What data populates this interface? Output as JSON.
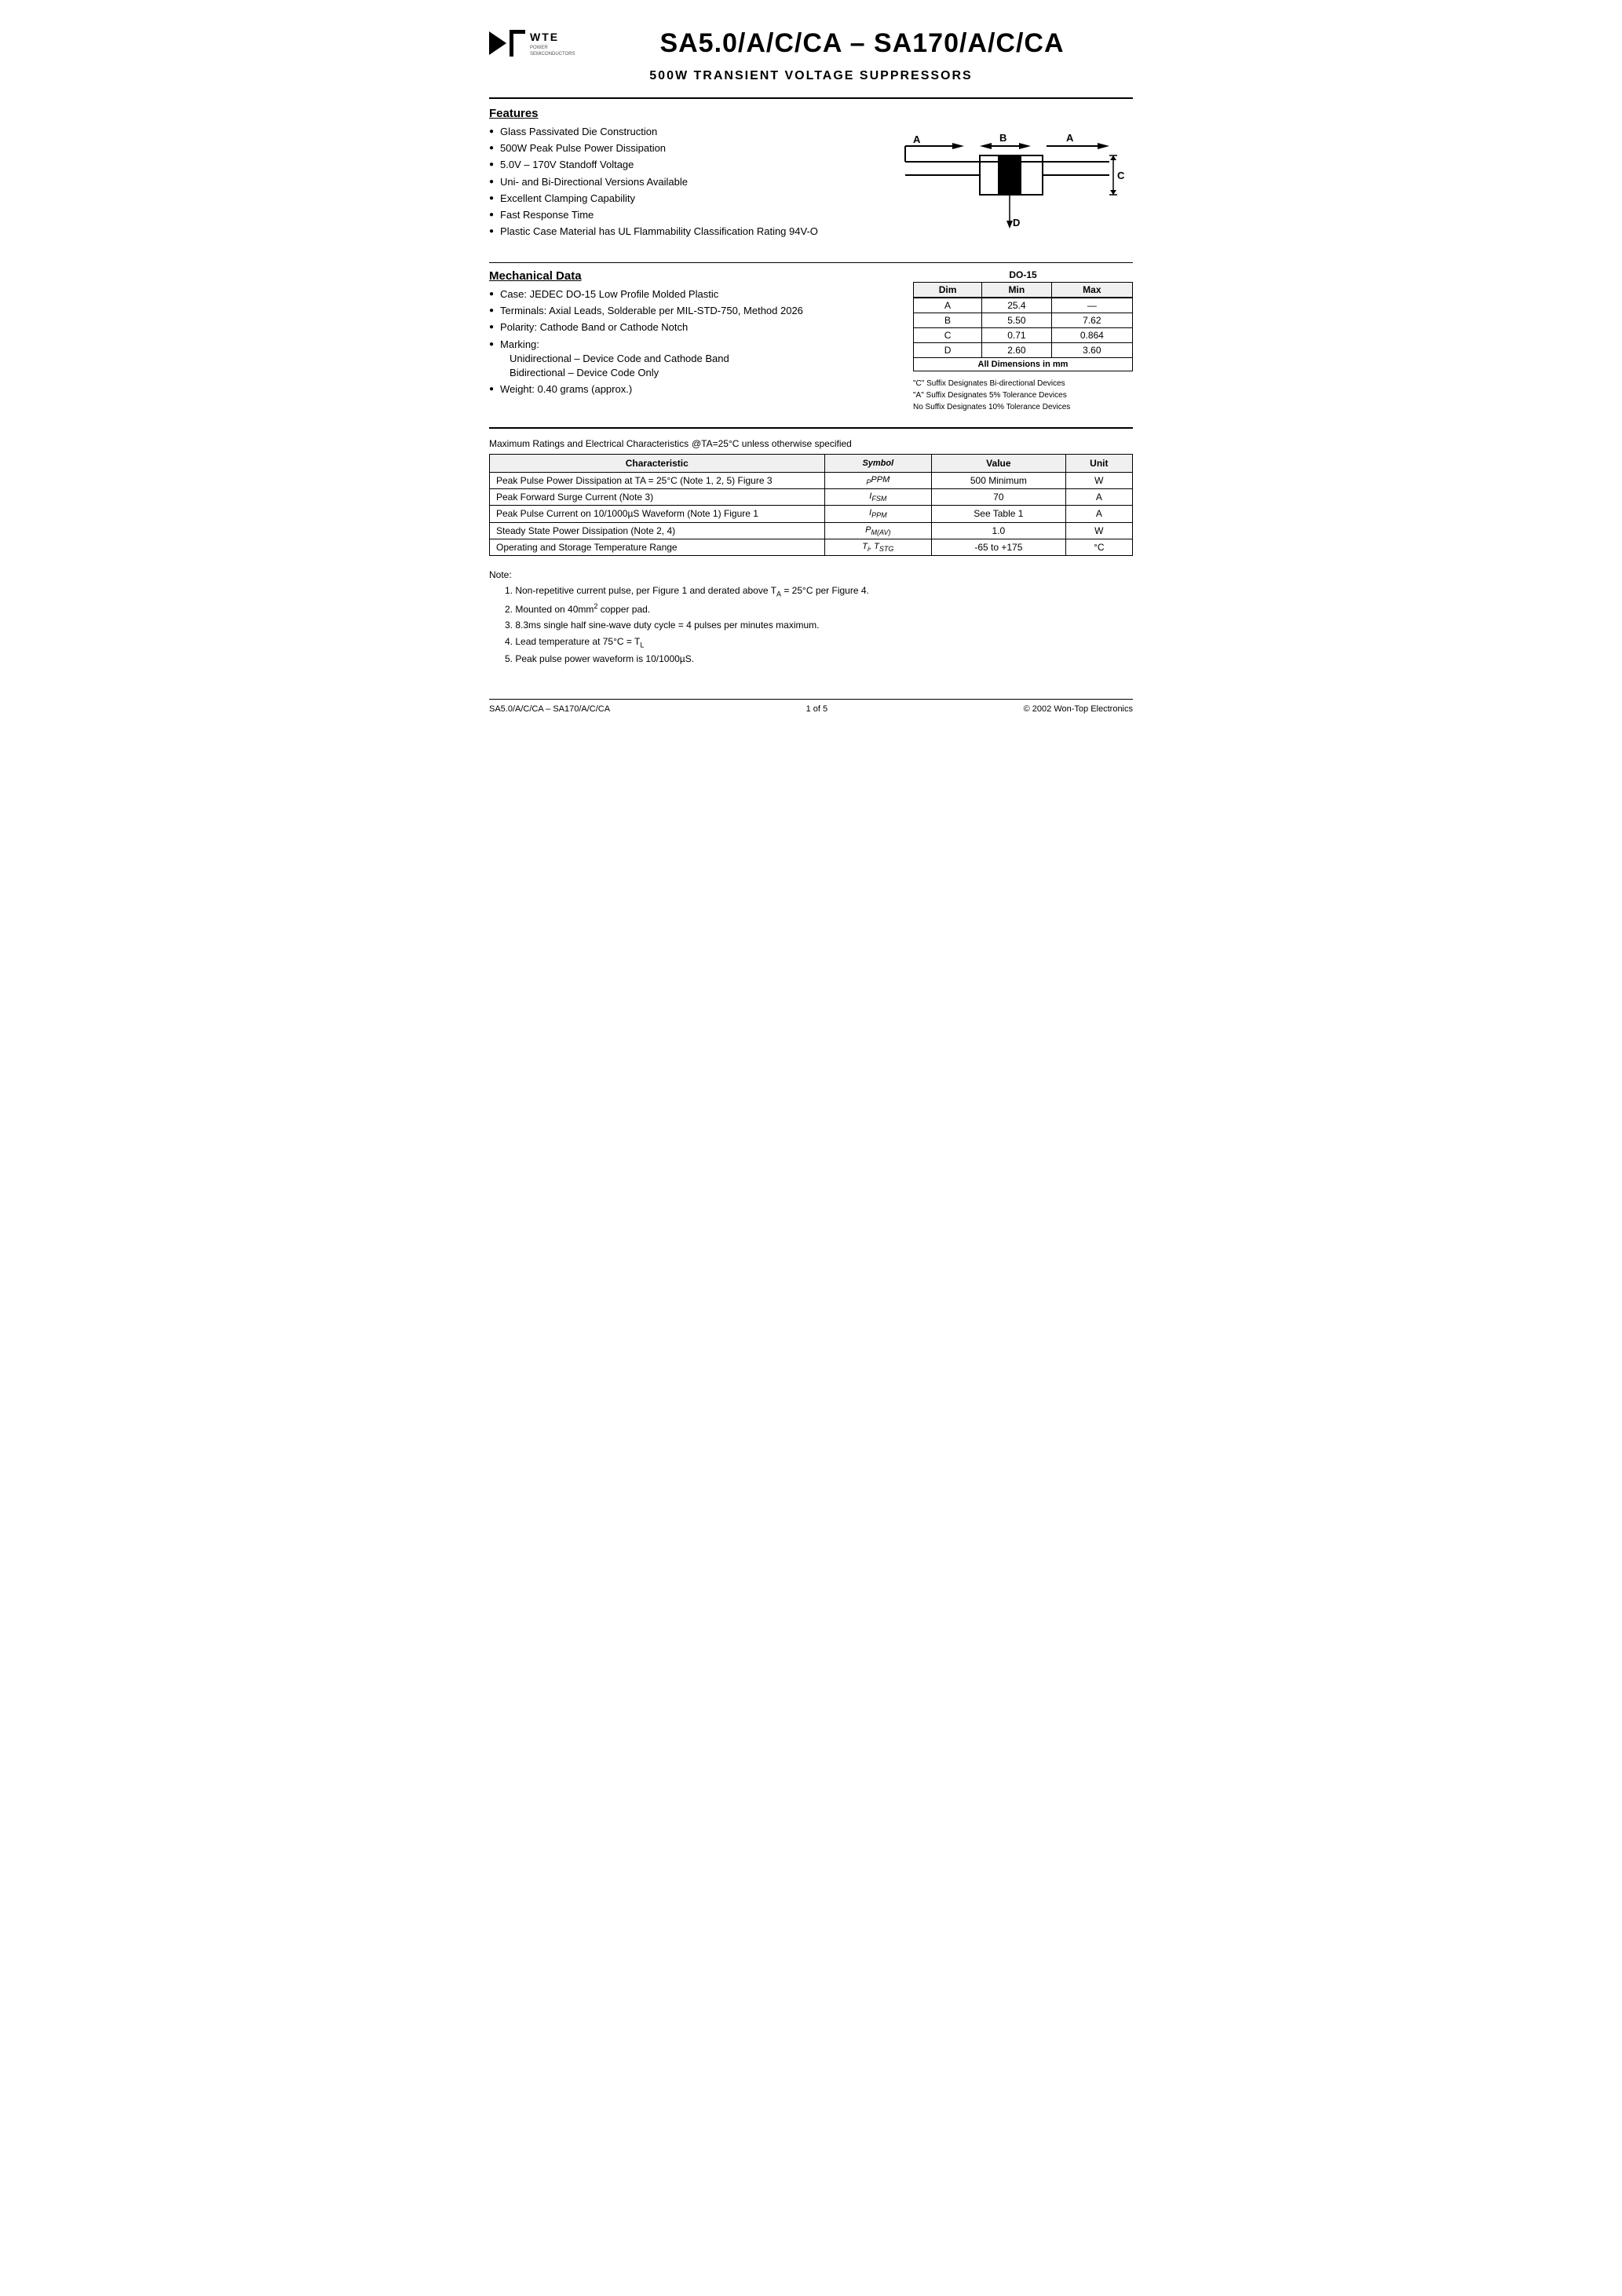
{
  "header": {
    "logo_wte": "WTE",
    "logo_power": "POWER SEMICONDUCTORS",
    "main_title": "SA5.0/A/C/CA – SA170/A/C/CA",
    "subtitle": "500W TRANSIENT VOLTAGE SUPPRESSORS"
  },
  "features": {
    "title": "Features",
    "items": [
      "Glass Passivated Die Construction",
      "500W Peak Pulse Power Dissipation",
      "5.0V – 170V Standoff Voltage",
      "Uni- and Bi-Directional Versions Available",
      "Excellent Clamping Capability",
      "Fast Response Time",
      "Plastic Case Material has UL Flammability Classification Rating 94V-O"
    ]
  },
  "mechanical": {
    "title": "Mechanical Data",
    "items": [
      "Case: JEDEC DO-15 Low Profile Molded Plastic",
      "Terminals: Axial Leads, Solderable per MIL-STD-750, Method 2026",
      "Polarity: Cathode Band or Cathode Notch",
      "Marking:",
      "Unidirectional – Device Code and Cathode Band",
      "Bidirectional – Device Code Only",
      "Weight: 0.40 grams (approx.)"
    ]
  },
  "do15_table": {
    "title": "DO-15",
    "headers": [
      "Dim",
      "Min",
      "Max"
    ],
    "rows": [
      {
        "dim": "A",
        "min": "25.4",
        "max": "—"
      },
      {
        "dim": "B",
        "min": "5.50",
        "max": "7.62"
      },
      {
        "dim": "C",
        "min": "0.71",
        "max": "0.864"
      },
      {
        "dim": "D",
        "min": "2.60",
        "max": "3.60"
      }
    ],
    "footer": "All Dimensions in mm"
  },
  "suffix_notes": [
    "\"C\" Suffix Designates Bi-directional Devices",
    "\"A\" Suffix Designates 5% Tolerance Devices",
    "No Suffix Designates 10% Tolerance Devices"
  ],
  "max_ratings": {
    "title": "Maximum Ratings and Electrical Characteristics",
    "condition": "@TA=25°C unless otherwise specified",
    "table_headers": [
      "Characteristic",
      "Symbol",
      "Value",
      "Unit"
    ],
    "rows": [
      {
        "characteristic": "Peak Pulse Power Dissipation at TA = 25°C (Note 1, 2, 5) Figure 3",
        "symbol": "PPPM",
        "value": "500 Minimum",
        "unit": "W"
      },
      {
        "characteristic": "Peak Forward Surge Current (Note 3)",
        "symbol": "IFSM",
        "value": "70",
        "unit": "A"
      },
      {
        "characteristic": "Peak Pulse Current on 10/1000µS Waveform (Note 1) Figure 1",
        "symbol": "IPPM",
        "value": "See Table 1",
        "unit": "A"
      },
      {
        "characteristic": "Steady State Power Dissipation (Note 2, 4)",
        "symbol": "PM(AV)",
        "value": "1.0",
        "unit": "W"
      },
      {
        "characteristic": "Operating and Storage Temperature Range",
        "symbol": "Ti, TSTG",
        "value": "-65 to +175",
        "unit": "°C"
      }
    ]
  },
  "notes": {
    "title": "Note:",
    "items": [
      "1. Non-repetitive current pulse, per Figure 1 and derated above TA = 25°C per Figure 4.",
      "2. Mounted on 40mm² copper pad.",
      "3. 8.3ms single half sine-wave duty cycle = 4 pulses per minutes maximum.",
      "4. Lead temperature at 75°C = TL",
      "5. Peak pulse power waveform is 10/1000µS."
    ]
  },
  "footer": {
    "left": "SA5.0/A/C/CA – SA170/A/C/CA",
    "center": "1 of 5",
    "right": "© 2002 Won-Top Electronics"
  }
}
